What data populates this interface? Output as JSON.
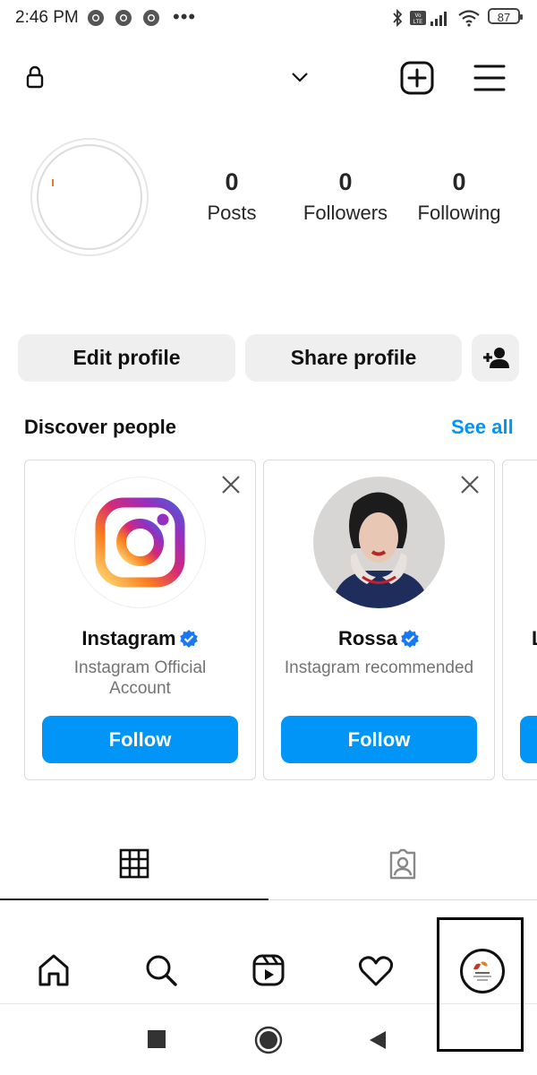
{
  "status_bar": {
    "time": "2:46 PM",
    "battery": "87",
    "more": "•••"
  },
  "profile": {
    "stats": [
      {
        "value": "0",
        "label": "Posts"
      },
      {
        "value": "0",
        "label": "Followers"
      },
      {
        "value": "0",
        "label": "Following"
      }
    ],
    "edit_label": "Edit profile",
    "share_label": "Share profile"
  },
  "discover": {
    "title": "Discover people",
    "see_all": "See all",
    "cards": [
      {
        "name": "Instagram",
        "subtitle": "Instagram Official Account",
        "follow": "Follow",
        "verified": true,
        "avatar_icon": "instagram-logo-icon"
      },
      {
        "name": "Rossa",
        "subtitle": "Instagram recommended",
        "follow": "Follow",
        "verified": true,
        "avatar_icon": "person-photo"
      },
      {
        "name": "L",
        "subtitle": "",
        "follow": "Follow"
      }
    ]
  },
  "colors": {
    "accent": "#0095f6",
    "button_gray": "#efefef",
    "text_secondary": "#737373",
    "verified": "#1877f2"
  },
  "icons": {
    "top_nav": [
      "lock-icon",
      "chevron-down-icon",
      "new-post-icon",
      "menu-icon"
    ],
    "tabs": [
      "grid-icon",
      "tagged-icon"
    ],
    "bottom_nav": [
      "home-icon",
      "search-icon",
      "reels-icon",
      "heart-icon",
      "profile-avatar"
    ],
    "system_nav": [
      "recents-square-icon",
      "home-circle-icon",
      "back-triangle-icon"
    ]
  }
}
